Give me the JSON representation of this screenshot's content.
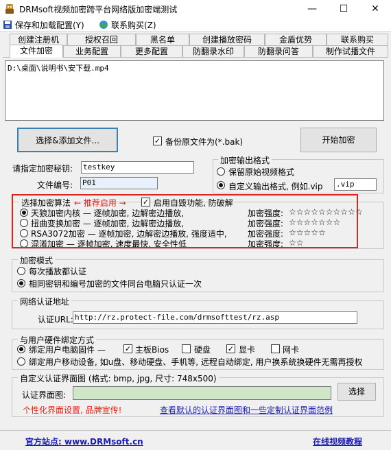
{
  "window": {
    "title": "DRMsoft视频加密跨平台网络版加密端测试",
    "min_glyph": "—",
    "max_glyph": "☐",
    "close_glyph": "✕"
  },
  "menu": {
    "save_label": "保存和加载配置(Y)",
    "buy_label": "联系购买(Z)"
  },
  "tabs_row1": [
    "创建注册机",
    "授权召回",
    "黑名单",
    "创建播放密码",
    "金盾优势",
    "联系购买"
  ],
  "tabs_row2": [
    "文件加密",
    "业务配置",
    "更多配置",
    "防翻录水印",
    "防翻录问答",
    "制作试播文件"
  ],
  "active_tab": "文件加密",
  "file_list": {
    "path": "D:\\桌面\\说明书\\安下载.mp4"
  },
  "actions": {
    "choose_label": "选择&添加文件...",
    "backup_label": "备份原文件为(*.bak)",
    "backup_checked": true,
    "start_label": "开始加密"
  },
  "key": {
    "label": "请指定加密秘钥:",
    "value": "testkey"
  },
  "file_no": {
    "label": "文件编号:",
    "value": "P01"
  },
  "output_format": {
    "legend": "加密输出格式",
    "option_keep": "保留原始视频格式",
    "option_custom": "自定义输出格式, 例如.vip",
    "custom_value": ".vip",
    "selected": "custom"
  },
  "algorithm": {
    "legend": "选择加密算法",
    "recommend": "← 推荐启用 →",
    "selfdestruct_label": "启用自毁功能, 防破解",
    "selfdestruct_checked": true,
    "options": [
      {
        "label": "天狼加密内核 — 逐帧加密, 边解密边播放,",
        "strength_label": "加密强度:",
        "stars": "☆☆☆☆☆☆☆☆☆☆",
        "selected": true
      },
      {
        "label": "扭曲变换加密 — 逐帧加密, 边解密边播放,",
        "strength_label": "加密强度:",
        "stars": "☆☆☆☆☆☆☆",
        "selected": false
      },
      {
        "label": "RSA3072加密 — 逐帧加密, 边解密边播放, 强度适中,",
        "strength_label": "加密强度:",
        "stars": "☆☆☆☆☆",
        "selected": false
      },
      {
        "label": "混淆加密 — 逐帧加密, 速度最快, 安全性低",
        "strength_label": "加密强度:",
        "stars": "☆☆",
        "selected": false
      }
    ]
  },
  "mode": {
    "legend": "加密模式",
    "option_each": "每次播放都认证",
    "option_same": "相同密钥和编号加密的文件同台电脑只认证一次",
    "selected": "same"
  },
  "network": {
    "legend": "网络认证地址",
    "label": "认证URL:",
    "value": "http://rz.protect-file.com/drmsofttest/rz.asp"
  },
  "hardware": {
    "legend": "与用户硬件绑定方式",
    "option_pc": "绑定用户电脑固件 —",
    "checks": [
      {
        "label": "主板Bios",
        "checked": true
      },
      {
        "label": "硬盘",
        "checked": false
      },
      {
        "label": "显卡",
        "checked": true
      },
      {
        "label": "网卡",
        "checked": false
      }
    ],
    "option_mobile": "绑定用户移动设备, 如u盘、移动硬盘、手机等, 远程自动绑定, 用户换系统换硬件无需再授权",
    "selected": "pc"
  },
  "auth_image": {
    "legend": "自定义认证界面图 (格式: bmp, jpg, 尺寸: 748x500)",
    "label": "认证界面图:",
    "value": "",
    "select_label": "选择",
    "promo": "个性化界面设置, 品牌宣传!",
    "link": "查看默认的认证界面图和一些定制认证界面范例"
  },
  "footer": {
    "site": "官方站点: www.DRMsoft.cn",
    "tutorial": "在线视频教程"
  },
  "colors": {
    "accent_red": "#e2231a",
    "link_blue": "#1a1ab4",
    "image_field_green": "#cfe6c9"
  }
}
